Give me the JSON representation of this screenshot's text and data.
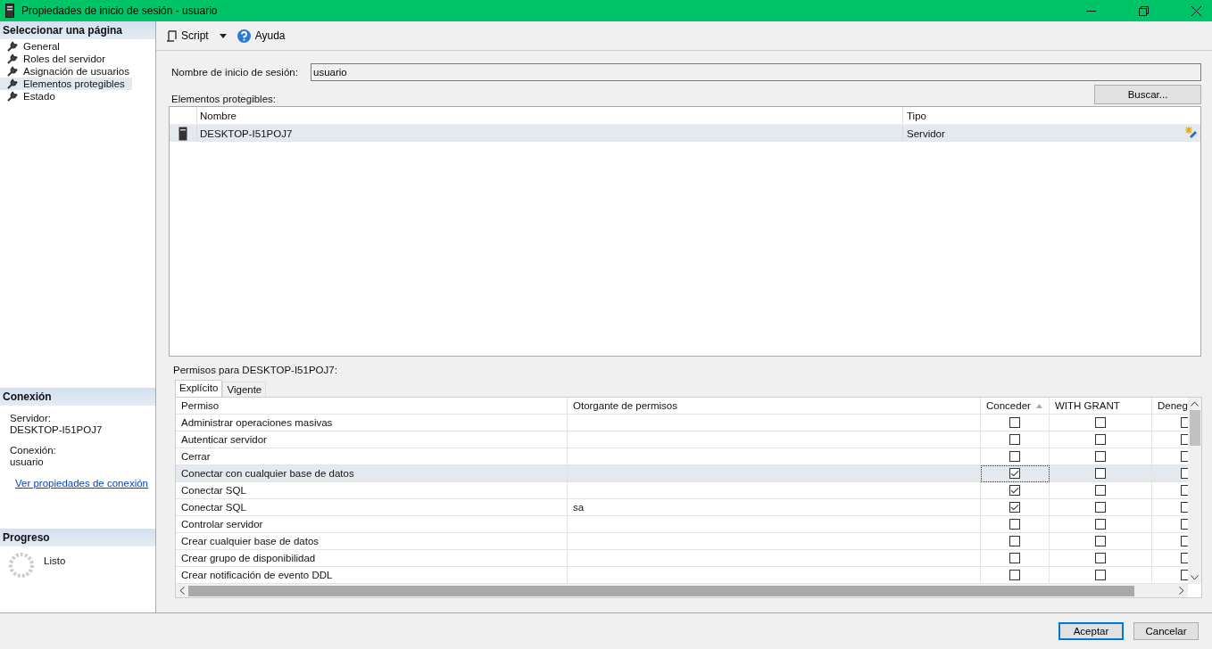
{
  "window": {
    "title": "Propiedades de inicio de sesión - usuario"
  },
  "sidebar": {
    "heading": "Seleccionar una página",
    "items": [
      {
        "label": "General",
        "selected": false
      },
      {
        "label": "Roles del servidor",
        "selected": false
      },
      {
        "label": "Asignación de usuarios",
        "selected": false
      },
      {
        "label": "Elementos protegibles",
        "selected": true
      },
      {
        "label": "Estado",
        "selected": false
      }
    ]
  },
  "connection": {
    "heading": "Conexión",
    "server_label": "Servidor:",
    "server": "DESKTOP-I51POJ7",
    "connection_label": "Conexión:",
    "connection": "usuario",
    "link": "Ver propiedades de conexión"
  },
  "progress": {
    "heading": "Progreso",
    "status": "Listo"
  },
  "toolbar": {
    "script": "Script",
    "help": "Ayuda"
  },
  "login": {
    "label": "Nombre de inicio de sesión:",
    "value": "usuario"
  },
  "securables": {
    "label": "Elementos protegibles:",
    "search_button": "Buscar...",
    "columns": [
      "Nombre",
      "Tipo"
    ],
    "rows": [
      {
        "name": "DESKTOP-I51POJ7",
        "type": "Servidor",
        "selected": true
      }
    ]
  },
  "permissions": {
    "label": "Permisos para DESKTOP-I51POJ7:",
    "tabs": [
      {
        "label": "Explícito",
        "selected": true
      },
      {
        "label": "Vigente",
        "selected": false
      }
    ],
    "columns": [
      "Permiso",
      "Otorgante de permisos",
      "Conceder",
      "WITH GRANT",
      "Deneg"
    ],
    "rows": [
      {
        "permission": "Administrar operaciones masivas",
        "grant": false,
        "with_grant": false,
        "deny": false,
        "selected": false
      },
      {
        "permission": "Autenticar servidor",
        "grant": false,
        "with_grant": false,
        "deny": false,
        "selected": false
      },
      {
        "permission": "Cerrar",
        "grant": false,
        "with_grant": false,
        "deny": false,
        "selected": false
      },
      {
        "permission": "Conectar con cualquier base de datos",
        "grant": true,
        "with_grant": false,
        "deny": false,
        "selected": true
      },
      {
        "permission": "Conectar SQL",
        "grant": true,
        "with_grant": false,
        "deny": false,
        "selected": false
      },
      {
        "permission": "Conectar SQL",
        "grantor": "sa",
        "grant": true,
        "with_grant": false,
        "deny": false,
        "selected": false
      },
      {
        "permission": "Controlar servidor",
        "grant": false,
        "with_grant": false,
        "deny": false,
        "selected": false
      },
      {
        "permission": "Crear cualquier base de datos",
        "grant": false,
        "with_grant": false,
        "deny": false,
        "selected": false
      },
      {
        "permission": "Crear grupo de disponibilidad",
        "grant": false,
        "with_grant": false,
        "deny": false,
        "selected": false
      },
      {
        "permission": "Crear notificación de evento DDL",
        "grant": false,
        "with_grant": false,
        "deny": false,
        "selected": false
      }
    ]
  },
  "buttons": [
    {
      "label": "Aceptar",
      "default": true
    },
    {
      "label": "Cancelar",
      "default": false
    }
  ]
}
